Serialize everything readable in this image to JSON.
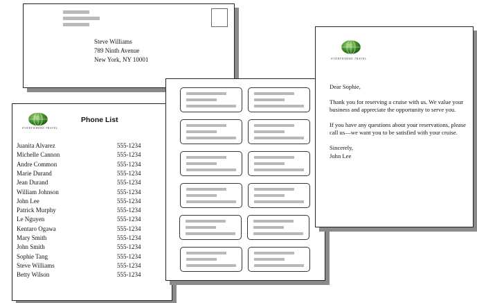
{
  "envelope": {
    "recipient_name": "Steve Williams",
    "street": "789 Ninth Avenue",
    "city_state_zip": "New York, NY 10001"
  },
  "phone_list": {
    "title": "Phone List",
    "brand": "EVERYWHERE TRAVEL",
    "entries": [
      {
        "name": "Juanita Alvarez",
        "phone": "555-1234"
      },
      {
        "name": "Michelle Cannon",
        "phone": "555-1234"
      },
      {
        "name": "Andre Common",
        "phone": "555-1234"
      },
      {
        "name": "Marie Durand",
        "phone": "555-1234"
      },
      {
        "name": "Jean Durand",
        "phone": "555-1234"
      },
      {
        "name": "William Johnson",
        "phone": "555-1234"
      },
      {
        "name": "John Lee",
        "phone": "555-1234"
      },
      {
        "name": "Patrick Murphy",
        "phone": "555-1234"
      },
      {
        "name": "Le Nguyen",
        "phone": "555-1234"
      },
      {
        "name": "Kentaro Ogawa",
        "phone": "555-1234"
      },
      {
        "name": "Mary Smith",
        "phone": "555-1234"
      },
      {
        "name": "John Smith",
        "phone": "555-1234"
      },
      {
        "name": "Sophie Tang",
        "phone": "555-1234"
      },
      {
        "name": "Steve Williams",
        "phone": "555-1234"
      },
      {
        "name": "Betty Wilson",
        "phone": "555-1234"
      }
    ]
  },
  "letter": {
    "brand": "EVERYWHERE TRAVEL",
    "salutation": "Dear Sophie,",
    "paragraph1": "Thank you for reserving a cruise with us. We value your business and appreciate the opportunity to serve you.",
    "paragraph2": "If you have any questions about your reservations, please call us—we want you to be satisfied with your cruise.",
    "closing": "Sincerely,",
    "signature": "John Lee"
  },
  "colors": {
    "placeholder_gray": "#b9b9b9",
    "shadow": "#8a8a8a",
    "globe_green": "#3f8f2a"
  }
}
